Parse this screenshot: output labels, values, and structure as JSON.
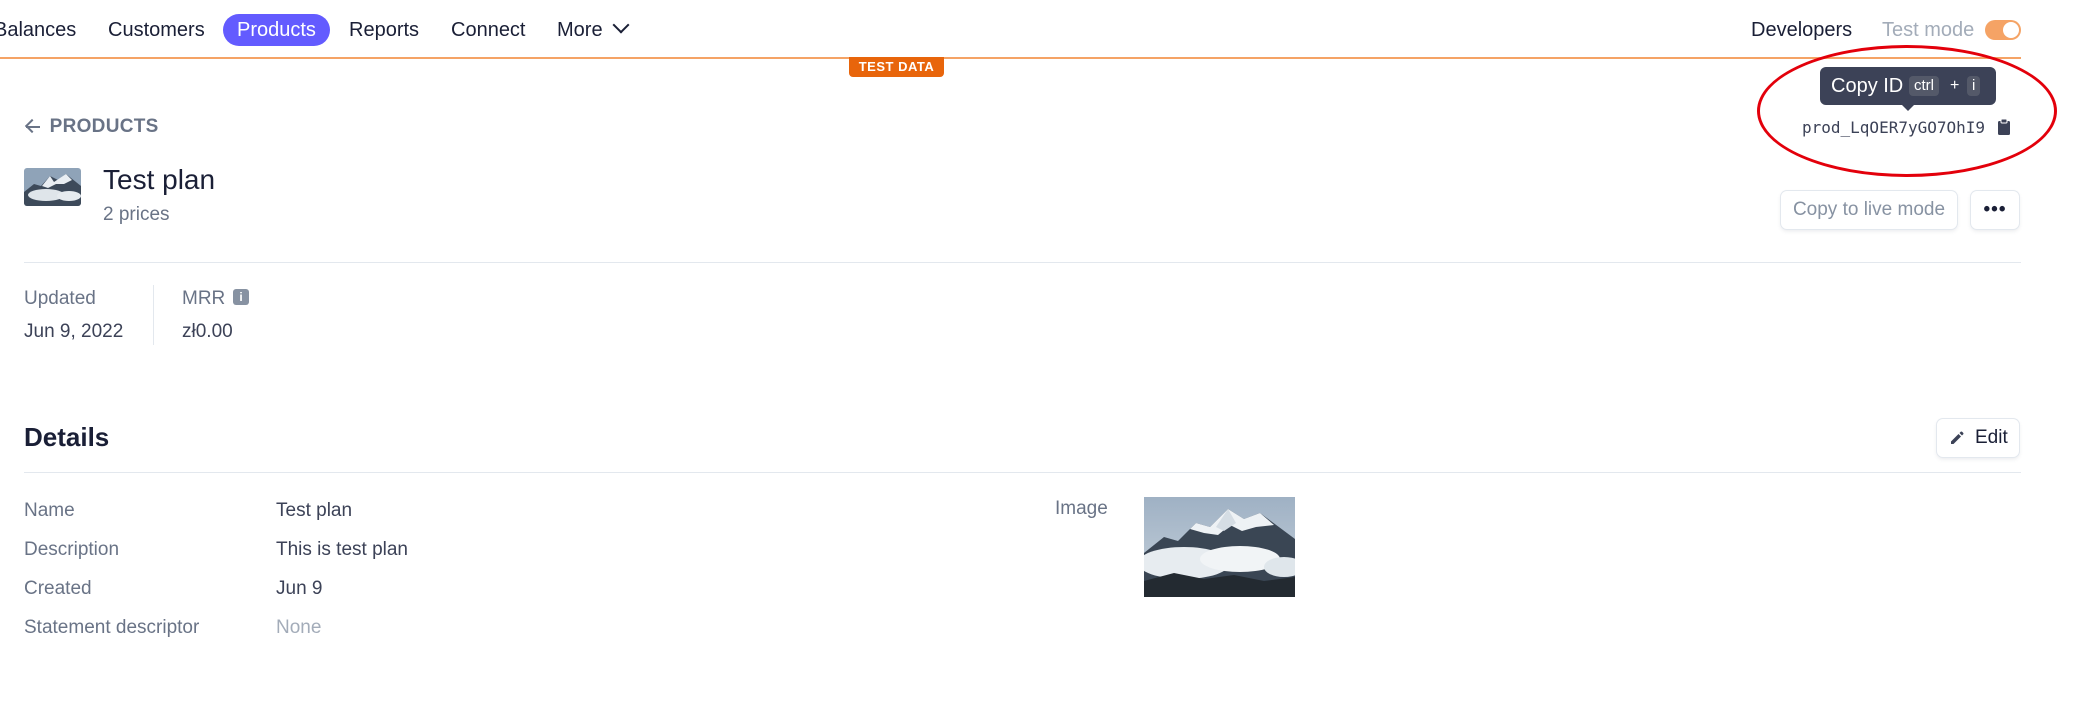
{
  "nav": {
    "items": [
      {
        "label": "Balances"
      },
      {
        "label": "Customers"
      },
      {
        "label": "Products"
      },
      {
        "label": "Reports"
      },
      {
        "label": "Connect"
      },
      {
        "label": "More"
      }
    ],
    "developers": "Developers",
    "test_mode_label": "Test mode",
    "test_mode_on": true,
    "test_data_badge": "TEST DATA",
    "accent_color": "#635bff",
    "test_mode_color": "#f5a365"
  },
  "breadcrumb": {
    "label": "PRODUCTS",
    "icon": "arrow-left-icon"
  },
  "product": {
    "title": "Test plan",
    "prices_count": "2 prices",
    "id": "prod_LqOER7yGO7OhI9",
    "copy_id_tooltip": {
      "label": "Copy ID",
      "key1": "ctrl",
      "plus": "+",
      "key2": "i"
    }
  },
  "actions": {
    "copy_to_live": "Copy to live mode",
    "more": "•••",
    "edit": "Edit"
  },
  "stats": {
    "updated_label": "Updated",
    "updated_value": "Jun 9, 2022",
    "mrr_label": "MRR",
    "mrr_value": "zł0.00"
  },
  "details": {
    "title": "Details",
    "rows": [
      {
        "label": "Name",
        "value": "Test plan"
      },
      {
        "label": "Description",
        "value": "This is test plan"
      },
      {
        "label": "Created",
        "value": "Jun 9"
      },
      {
        "label": "Statement descriptor",
        "value": "None"
      }
    ],
    "image_label": "Image"
  },
  "annotation": {
    "color": "#e3000b"
  }
}
